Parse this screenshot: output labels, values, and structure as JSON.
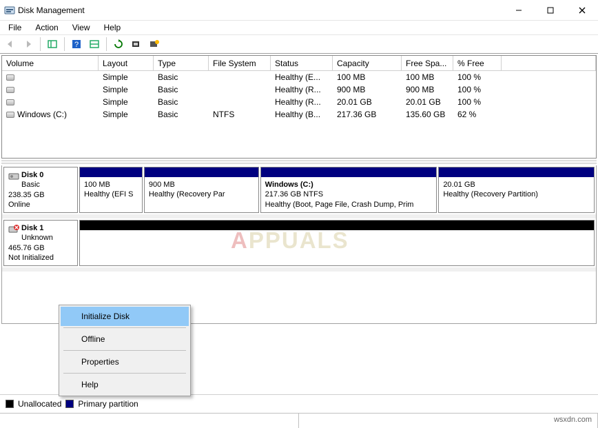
{
  "window": {
    "title": "Disk Management"
  },
  "menu": {
    "file": "File",
    "action": "Action",
    "view": "View",
    "help": "Help"
  },
  "columns": {
    "volume": "Volume",
    "layout": "Layout",
    "type": "Type",
    "fs": "File System",
    "status": "Status",
    "capacity": "Capacity",
    "free": "Free Spa...",
    "pct": "% Free"
  },
  "volumes": [
    {
      "name": "",
      "layout": "Simple",
      "type": "Basic",
      "fs": "",
      "status": "Healthy (E...",
      "capacity": "100 MB",
      "free": "100 MB",
      "pct": "100 %"
    },
    {
      "name": "",
      "layout": "Simple",
      "type": "Basic",
      "fs": "",
      "status": "Healthy (R...",
      "capacity": "900 MB",
      "free": "900 MB",
      "pct": "100 %"
    },
    {
      "name": "",
      "layout": "Simple",
      "type": "Basic",
      "fs": "",
      "status": "Healthy (R...",
      "capacity": "20.01 GB",
      "free": "20.01 GB",
      "pct": "100 %"
    },
    {
      "name": "Windows (C:)",
      "layout": "Simple",
      "type": "Basic",
      "fs": "NTFS",
      "status": "Healthy (B...",
      "capacity": "217.36 GB",
      "free": "135.60 GB",
      "pct": "62 %"
    }
  ],
  "disks": [
    {
      "name": "Disk 0",
      "type": "Basic",
      "size": "238.35 GB",
      "state": "Online",
      "icon": "disk",
      "parts": [
        {
          "title": "",
          "size": "100 MB",
          "status": "Healthy (EFI S",
          "stripe": "navy",
          "flex": 12
        },
        {
          "title": "",
          "size": "900 MB",
          "status": "Healthy (Recovery Par",
          "stripe": "navy",
          "flex": 22
        },
        {
          "title": "Windows  (C:)",
          "size": "217.36 GB NTFS",
          "status": "Healthy (Boot, Page File, Crash Dump, Prim",
          "stripe": "navy",
          "flex": 34
        },
        {
          "title": "",
          "size": "20.01 GB",
          "status": "Healthy (Recovery Partition)",
          "stripe": "navy",
          "flex": 30
        }
      ]
    },
    {
      "name": "Disk 1",
      "type": "Unknown",
      "size": "465.76 GB",
      "state": "Not Initialized",
      "icon": "disk-error",
      "parts": [
        {
          "title": "",
          "size": "",
          "status": "",
          "stripe": "black",
          "flex": 100
        }
      ]
    }
  ],
  "context_menu": {
    "initialize": "Initialize Disk",
    "offline": "Offline",
    "properties": "Properties",
    "help": "Help"
  },
  "legend": {
    "unalloc": "Unallocated",
    "primary": "Primary partition"
  },
  "footer": {
    "credit": "wsxdn.com"
  },
  "watermark": {
    "a": "A",
    "rest": "PPUALS"
  }
}
